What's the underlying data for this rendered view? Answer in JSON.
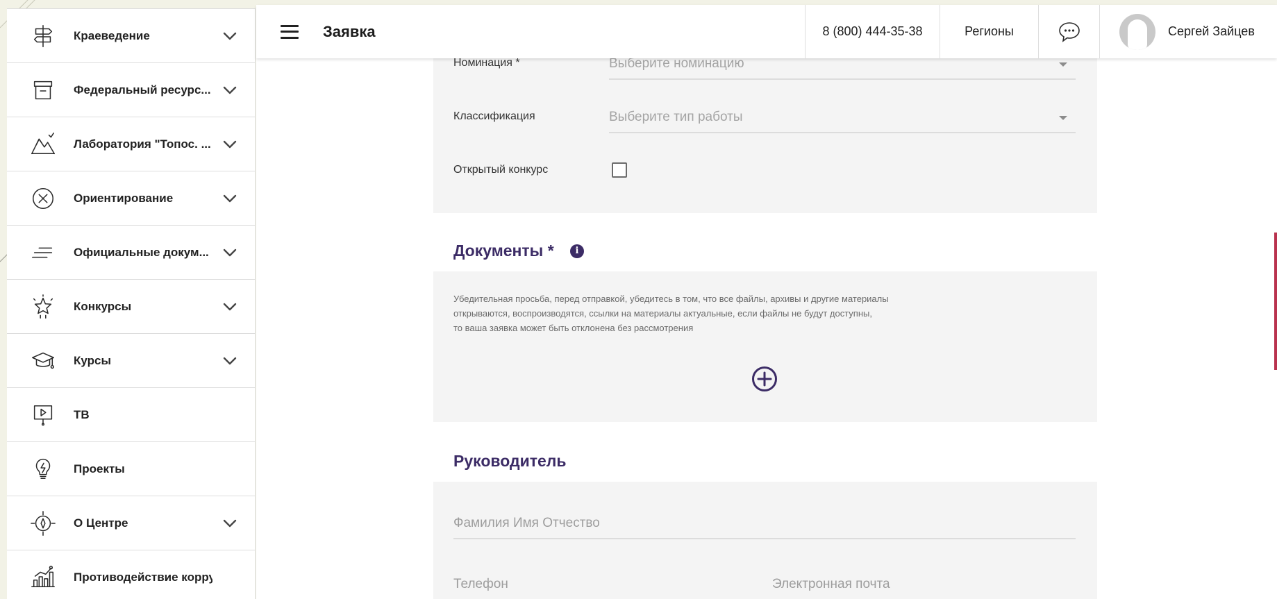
{
  "sidebar": {
    "items": [
      {
        "label": "Краеведение",
        "icon": "signpost-icon",
        "chevron": true
      },
      {
        "label": "Федеральный ресурс...",
        "icon": "archive-box-icon",
        "chevron": true
      },
      {
        "label": "Лаборатория \"Топос. ...",
        "icon": "mountains-icon",
        "chevron": true
      },
      {
        "label": "Ориентирование",
        "icon": "compass-icon",
        "chevron": true
      },
      {
        "label": "Официальные докум...",
        "icon": "lines-icon",
        "chevron": true
      },
      {
        "label": "Конкурсы",
        "icon": "star-icon",
        "chevron": true
      },
      {
        "label": "Курсы",
        "icon": "graduation-cap-icon",
        "chevron": true
      },
      {
        "label": "ТВ",
        "icon": "tv-screen-icon",
        "chevron": false
      },
      {
        "label": "Проекты",
        "icon": "lightbulb-icon",
        "chevron": false
      },
      {
        "label": "О Центре",
        "icon": "compass-rose-icon",
        "chevron": true
      },
      {
        "label": "Противодействие коррупц...",
        "icon": "bar-chart-icon",
        "chevron": false
      }
    ]
  },
  "header": {
    "title": "Заявка",
    "phone": "8 (800) 444-35-38",
    "regions": "Регионы",
    "user_name": "Сергей Зайцев"
  },
  "form": {
    "nomination_label": "Номинация *",
    "nomination_placeholder": "Выберите номинацию",
    "classification_label": "Классификация",
    "classification_placeholder": "Выберите тип работы",
    "open_contest_label": "Открытый конкурс",
    "open_contest_checked": false
  },
  "documents": {
    "title": "Документы *",
    "notice_lines": [
      "Убедительная просьба, перед отправкой, убедитесь в том, что все файлы, архивы и другие материалы",
      "открываются, воспроизводятся, ссылки на материалы актуальные, если файлы не будут доступны,",
      "то ваша заявка может быть отклонена без рассмотрения"
    ]
  },
  "supervisor": {
    "title": "Руководитель",
    "fio_placeholder": "Фамилия Имя Отчество",
    "phone_placeholder": "Телефон",
    "email_placeholder": "Электронная почта"
  },
  "colors": {
    "accent": "#3c2c66",
    "scroll_accent": "#b9324e",
    "page_bg": "#f2f2e6",
    "panel_bg": "#f4f4f4"
  }
}
